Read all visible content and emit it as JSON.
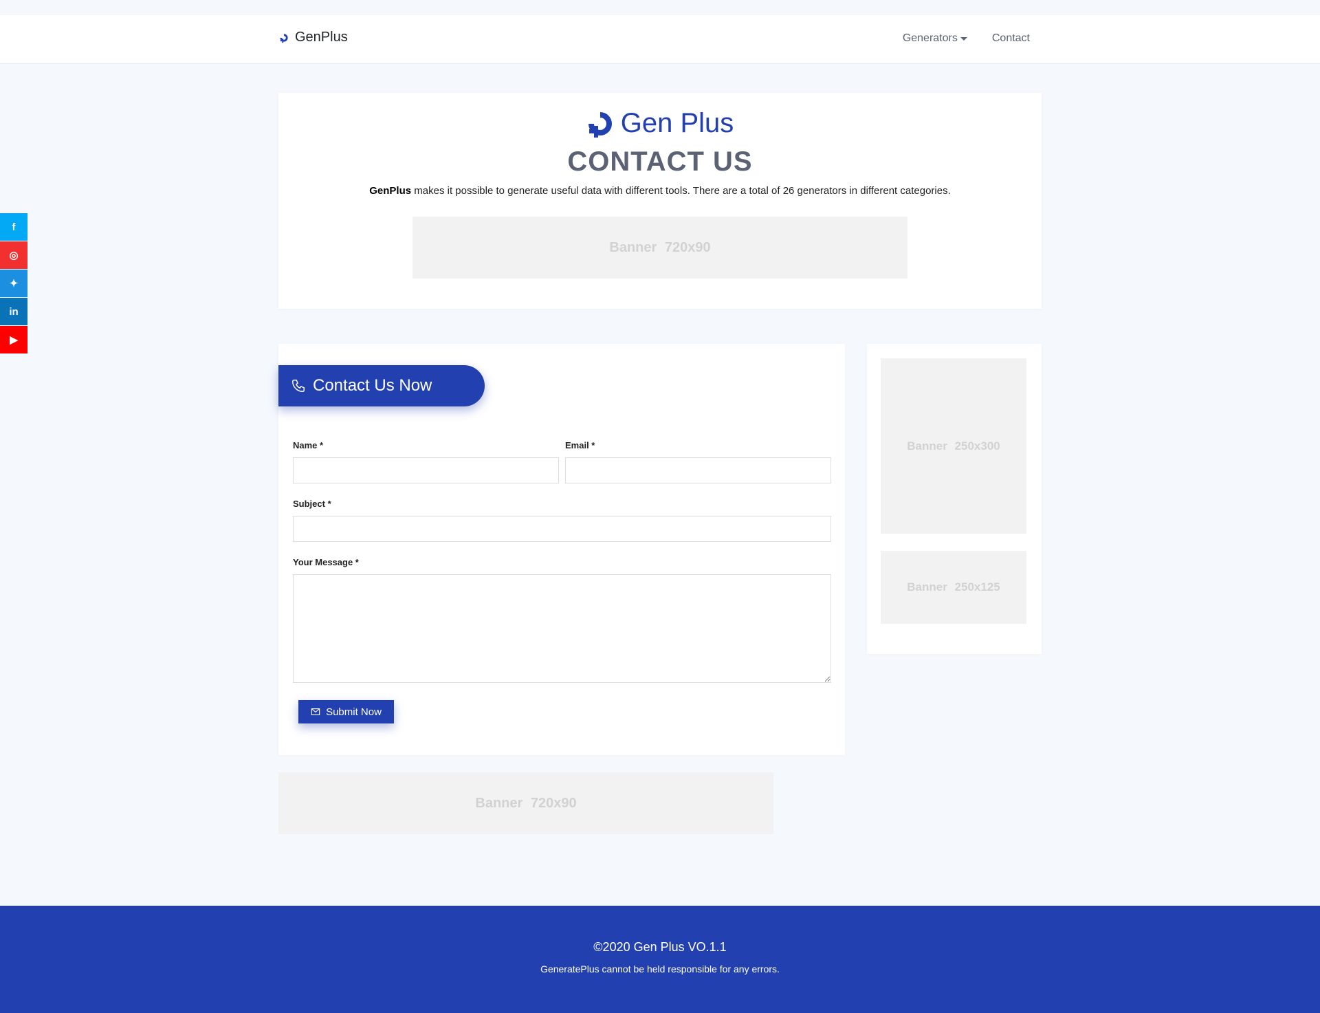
{
  "navbar": {
    "brand": "GenPlus",
    "links": [
      {
        "label": "Generators",
        "has_dropdown": true
      },
      {
        "label": "Contact",
        "has_dropdown": false
      }
    ]
  },
  "social": [
    {
      "name": "facebook",
      "glyph": "f",
      "color": "#03a9f4"
    },
    {
      "name": "instagram",
      "glyph": "◎",
      "color": "#f23030"
    },
    {
      "name": "twitter",
      "glyph": "✦",
      "color": "#1d8fe0"
    },
    {
      "name": "linkedin",
      "glyph": "in",
      "color": "#0a73b7"
    },
    {
      "name": "youtube",
      "glyph": "▶",
      "color": "#ff0000"
    }
  ],
  "hero": {
    "logo_text": "Gen Plus",
    "title": "CONTACT US",
    "desc_brand": "GenPlus",
    "desc_text": " makes it possible to generate useful data with different tools. There are a total of 26 generators in different categories.",
    "banner": "Banner 720x90"
  },
  "form": {
    "heading": "Contact Us Now",
    "name_label": "Name *",
    "name_value": "",
    "email_label": "Email *",
    "email_value": "",
    "subject_label": "Subject *",
    "subject_value": "",
    "message_label": "Your Message *",
    "message_value": "",
    "submit_label": "Submit Now"
  },
  "sidebar": {
    "banner_top": "Banner 250x300",
    "banner_bottom": "Banner 250x125"
  },
  "bottom_banner": "Banner 720x90",
  "footer": {
    "copyright": "©2020 Gen Plus VO.1.1",
    "note": "GeneratePlus cannot be held responsible for any errors."
  },
  "colors": {
    "primary": "#2240af",
    "background": "#f5f8fd",
    "banner_bg": "#f2f2f2"
  }
}
